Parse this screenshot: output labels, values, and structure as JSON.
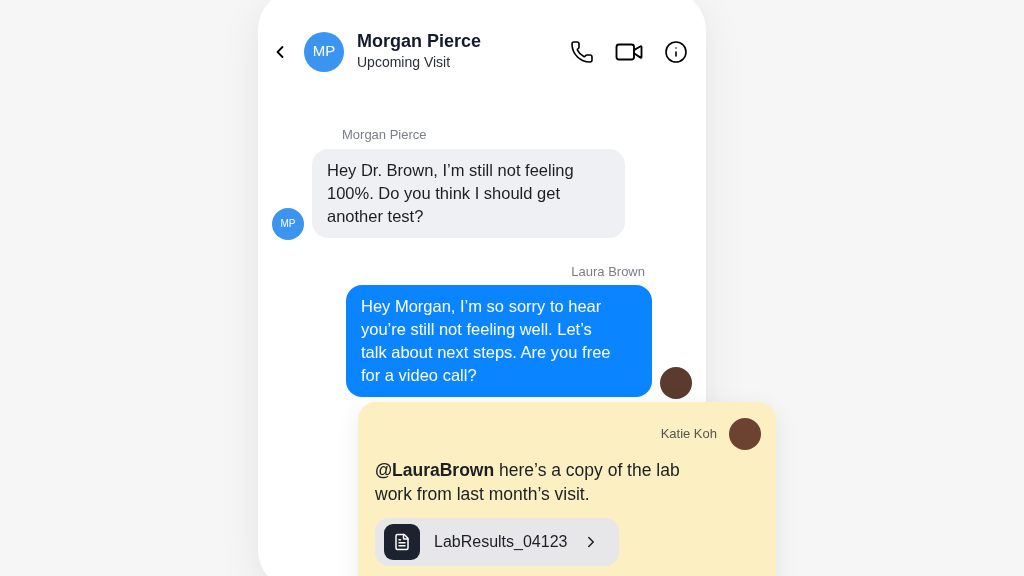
{
  "header": {
    "avatar_initials": "MP",
    "name": "Morgan Pierce",
    "status": "Upcoming Visit"
  },
  "messages": [
    {
      "kind": "incoming",
      "sender": "Morgan Pierce",
      "text": "Hey Dr. Brown, I’m still not feeling 100%. Do you think I should get another test?",
      "avatar_initials": "MP"
    },
    {
      "kind": "outgoing",
      "sender": "Laura Brown",
      "text": "Hey Morgan, I’m so sorry to hear you’re still not feeling well. Let’s talk about next steps. Are you free for a video call?"
    }
  ],
  "note": {
    "author": "Katie Koh",
    "text": "**@LauraBrown** here’s a copy of the lab work from last month’s visit.",
    "attachment": "LabResults_04123"
  }
}
